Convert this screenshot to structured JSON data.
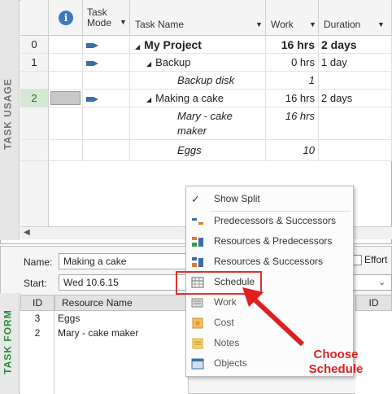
{
  "usage": {
    "band_label": "TASK USAGE",
    "columns": {
      "info_icon": "info-icon",
      "task_mode": "Task Mode",
      "task_name": "Task Name",
      "work": "Work",
      "duration": "Duration"
    },
    "rows": [
      {
        "id": "0",
        "name": "My Project",
        "work": "16 hrs",
        "duration": "2 days"
      },
      {
        "id": "1",
        "name": "Backup",
        "work": "0 hrs",
        "duration": "1 day"
      },
      {
        "id": "",
        "name": "Backup disk",
        "work": "1",
        "duration": ""
      },
      {
        "id": "2",
        "name": "Making a cake",
        "work": "16 hrs",
        "duration": "2 days"
      },
      {
        "id": "",
        "name": "Mary - cake maker",
        "work": "16 hrs",
        "duration": ""
      },
      {
        "id": "",
        "name": "Eggs",
        "work": "10",
        "duration": ""
      }
    ]
  },
  "form": {
    "band_label": "TASK FORM",
    "name_label": "Name:",
    "name_value": "Making a cake",
    "start_label": "Start:",
    "start_value": "Wed 10.6.15",
    "effort_label": "Effort",
    "table": {
      "id_header": "ID",
      "resource_header": "Resource Name",
      "id_header_right": "ID",
      "rows": [
        {
          "id": "3",
          "name": "Eggs"
        },
        {
          "id": "2",
          "name": "Mary - cake maker"
        }
      ]
    }
  },
  "menu": {
    "items": [
      {
        "label": "Show Split",
        "icon": "checkmark-icon"
      },
      {
        "label": "Predecessors & Successors",
        "icon": "predecessors-successors-icon"
      },
      {
        "label": "Resources & Predecessors",
        "icon": "resources-predecessors-icon"
      },
      {
        "label": "Resources & Successors",
        "icon": "resources-successors-icon"
      },
      {
        "label": "Schedule",
        "icon": "schedule-icon"
      },
      {
        "label": "Work",
        "icon": "work-icon"
      },
      {
        "label": "Cost",
        "icon": "cost-icon"
      },
      {
        "label": "Notes",
        "icon": "notes-icon"
      },
      {
        "label": "Objects",
        "icon": "objects-icon"
      }
    ]
  },
  "annotation": {
    "callout": "Choose Schedule",
    "color": "#e02020"
  }
}
